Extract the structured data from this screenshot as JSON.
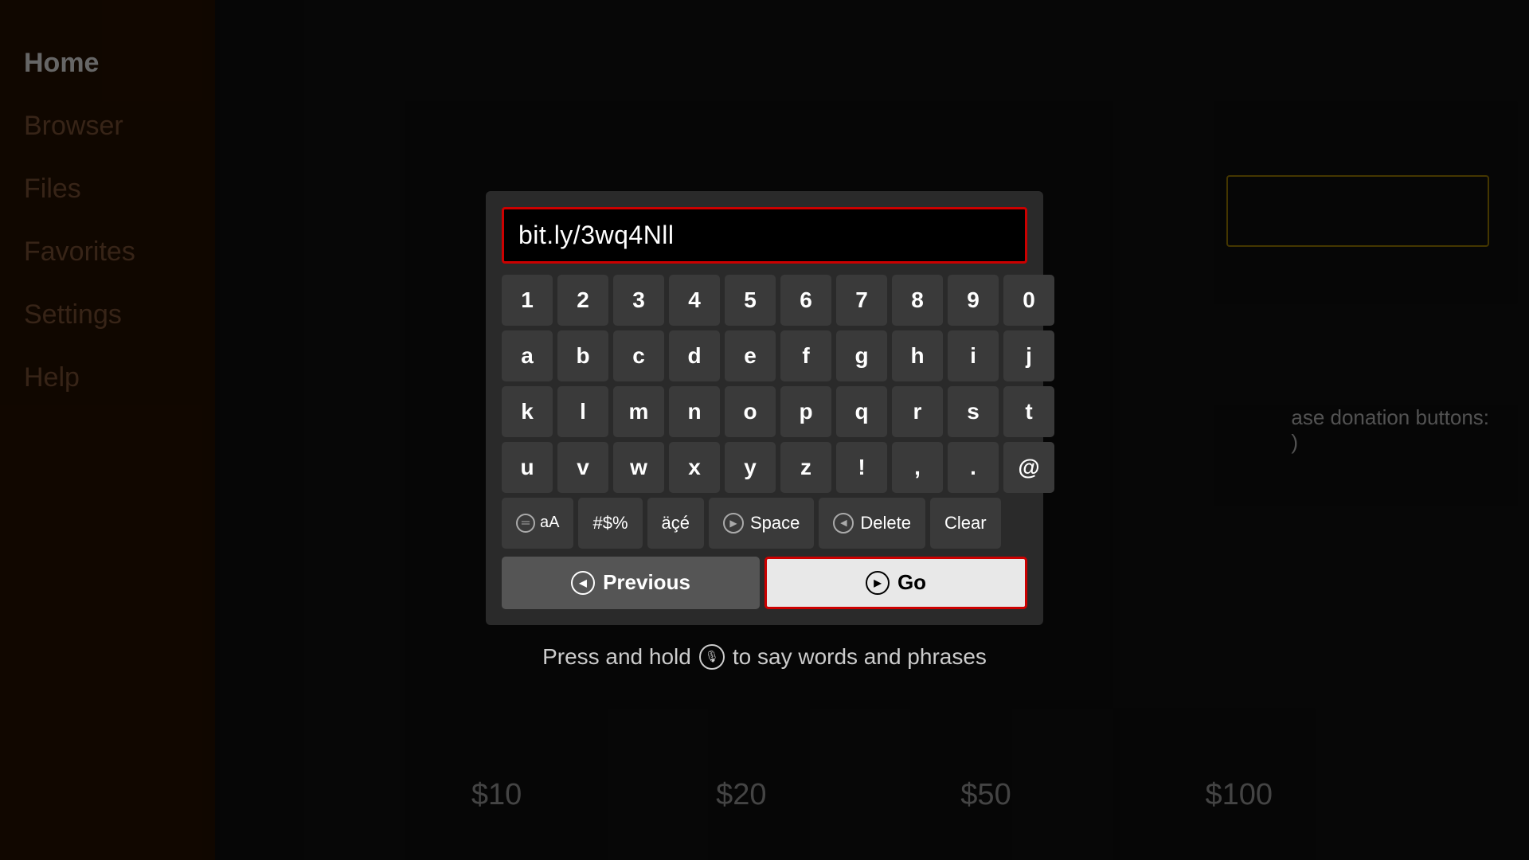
{
  "sidebar": {
    "items": [
      {
        "id": "home",
        "label": "Home",
        "active": true
      },
      {
        "id": "browser",
        "label": "Browser",
        "active": false
      },
      {
        "id": "files",
        "label": "Files",
        "active": false
      },
      {
        "id": "favorites",
        "label": "Favorites",
        "active": false
      },
      {
        "id": "settings",
        "label": "Settings",
        "active": false
      },
      {
        "id": "help",
        "label": "Help",
        "active": false
      }
    ]
  },
  "dialog": {
    "url_value": "bit.ly/3wq4Nll",
    "keyboard": {
      "row1": [
        "1",
        "2",
        "3",
        "4",
        "5",
        "6",
        "7",
        "8",
        "9",
        "0"
      ],
      "row2": [
        "a",
        "b",
        "c",
        "d",
        "e",
        "f",
        "g",
        "h",
        "i",
        "j"
      ],
      "row3": [
        "k",
        "l",
        "m",
        "n",
        "o",
        "p",
        "q",
        "r",
        "s",
        "t"
      ],
      "row4": [
        "u",
        "v",
        "w",
        "x",
        "y",
        "z",
        "!",
        ",",
        ".",
        "@"
      ],
      "bottom_keys": [
        {
          "id": "case",
          "label": "aA",
          "icon": "circle-equal"
        },
        {
          "id": "symbols",
          "label": "#$%"
        },
        {
          "id": "special",
          "label": "äçé"
        },
        {
          "id": "space",
          "label": "Space",
          "icon": "circle-play"
        },
        {
          "id": "delete",
          "label": "Delete",
          "icon": "circle-back"
        },
        {
          "id": "clear",
          "label": "Clear"
        }
      ]
    },
    "previous_label": "Previous",
    "go_label": "Go",
    "previous_icon": "circle-left",
    "go_icon": "circle-play-right"
  },
  "voice_hint": {
    "text_before": "Press and hold",
    "text_after": "to say words and phrases",
    "icon": "circle-mic"
  },
  "background": {
    "side_text": "ase donation buttons:",
    "side_text2": ")",
    "amounts": [
      "$10",
      "$20",
      "$50",
      "$100"
    ]
  }
}
